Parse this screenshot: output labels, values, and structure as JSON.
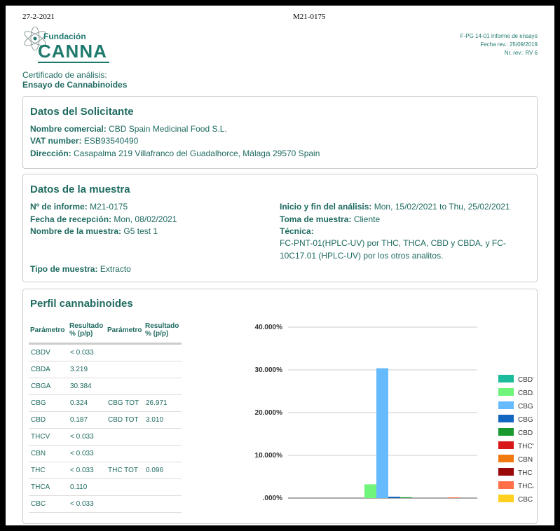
{
  "header": {
    "date": "27-2-2021",
    "code": "M21-0175"
  },
  "logo": {
    "small": "Fundación",
    "big": "CANNA"
  },
  "doc_meta": [
    "F-PG 14-01 Informe de ensayo",
    "Fecha rev.: 25/09/2019",
    "Nr. rev.: RV 6"
  ],
  "certificate": {
    "title": "Certificado de análisis:",
    "subtitle": "Ensayo de Cannabinoides"
  },
  "solicitante": {
    "heading": "Datos del Solicitante",
    "nombre_label": "Nombre comercial:",
    "nombre_value": "CBD Spain Medicinal Food S.L.",
    "vat_label": "VAT number:",
    "vat_value": "ESB93540490",
    "dir_label": "Dirección:",
    "dir_value": "Casapalma 219 Villafranco del Guadalhorce, Málaga 29570 Spain"
  },
  "muestra": {
    "heading": "Datos de la muestra",
    "informe_label": "Nº de informe:",
    "informe_value": "M21-0175",
    "recepcion_label": "Fecha de recepción:",
    "recepcion_value": "Mon, 08/02/2021",
    "nombre_label": "Nombre de la muestra:",
    "nombre_value": "G5 test 1",
    "tipo_label": "Tipo de muestra:",
    "tipo_value": "Extracto",
    "analisis_label": "Inicio y fin del análisis:",
    "analisis_value": "Mon, 15/02/2021 to Thu, 25/02/2021",
    "toma_label": "Toma de muestra:",
    "toma_value": "Cliente",
    "tecnica_label": "Técnica:",
    "tecnica_value": "FC-PNT-01(HPLC-UV) por THC, THCA, CBD y CBDA, y FC-10C17.01 (HPLC-UV) por los otros analitos."
  },
  "perfil": {
    "heading": "Perfil cannabinoides",
    "columns": {
      "param": "Parámetro",
      "result": "Resultado % (p/p)",
      "param2": "Parámetro",
      "result2": "Resultado % (p/p)"
    },
    "rows": [
      [
        "CBDV",
        "< 0.033",
        "",
        ""
      ],
      [
        "CBDA",
        "3.219",
        "",
        ""
      ],
      [
        "CBGA",
        "30.384",
        "",
        ""
      ],
      [
        "CBG",
        "0.324",
        "CBG TOT",
        "26.971"
      ],
      [
        "CBD",
        "0.187",
        "CBD TOT",
        "3.010"
      ],
      [
        "THCV",
        "< 0.033",
        "",
        ""
      ],
      [
        "CBN",
        "< 0.033",
        "",
        ""
      ],
      [
        "THC",
        "< 0.033",
        "THC TOT",
        "0.096"
      ],
      [
        "THCA",
        "0.110",
        "",
        ""
      ],
      [
        "CBC",
        "< 0.033",
        "",
        ""
      ]
    ]
  },
  "chart_data": {
    "type": "bar",
    "categories": [
      "CBDV",
      "CBDA",
      "CBGA",
      "CBG",
      "CBD",
      "THCV",
      "CBN",
      "THC",
      "THCA",
      "CBC"
    ],
    "values": [
      0,
      3.219,
      30.384,
      0.324,
      0.187,
      0,
      0,
      0,
      0.11,
      0
    ],
    "colors": [
      "#1abc9c",
      "#6ef57a",
      "#66bbff",
      "#1467c0",
      "#1a9a2e",
      "#d81818",
      "#f07a10",
      "#9a0808",
      "#ff6f48",
      "#ffd020"
    ],
    "yticks": [
      ".000%",
      "10.000%",
      "20.000%",
      "30.000%",
      "40.000%"
    ],
    "ylim": [
      0,
      40
    ],
    "legend_position": "right",
    "grid": true
  }
}
